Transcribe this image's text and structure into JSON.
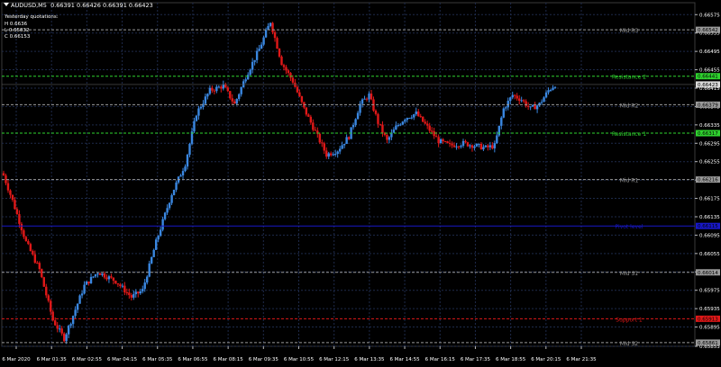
{
  "header": {
    "symbol": "AUDUSD,M5",
    "ohlc": "0.66391 0.66426 0.66391 0.66423"
  },
  "yesterday": {
    "title": "Yesterday quotations:",
    "high": "H  0.6636",
    "low": "L  0.65832",
    "close": "C  0.66153"
  },
  "colors": {
    "background": "#000000",
    "grid": "#1e2a4a",
    "axis": "#ffffff",
    "bull": "#3a87e0",
    "bear": "#e01818",
    "pivot": "#1818c8",
    "resistance": "#2fd32f",
    "support": "#e01818",
    "mid": "#9a9a9a"
  },
  "chart_data": {
    "type": "candlestick",
    "symbol": "AUDUSD",
    "timeframe": "M5",
    "ylim": [
      0.65853,
      0.66601
    ],
    "y_ticks": [
      "0.66575",
      "0.66535",
      "0.66495",
      "0.66455",
      "0.66415",
      "0.66375",
      "0.66335",
      "0.66295",
      "0.66255",
      "0.66215",
      "0.66175",
      "0.66135",
      "0.66095",
      "0.66055",
      "0.66015",
      "0.65975",
      "0.65935",
      "0.65895",
      "0.65853"
    ],
    "x_ticks": [
      "6 Mar 2020",
      "6 Mar 01:35",
      "6 Mar 02:55",
      "6 Mar 04:15",
      "6 Mar 05:35",
      "6 Mar 06:55",
      "6 Mar 08:15",
      "6 Mar 09:35",
      "6 Mar 10:55",
      "6 Mar 12:15",
      "6 Mar 13:35",
      "6 Mar 14:55",
      "6 Mar 16:15",
      "6 Mar 17:35",
      "6 Mar 18:55",
      "6 Mar 20:15",
      "6 Mar 21:35"
    ],
    "levels": [
      {
        "name": "Mid R3",
        "value": 0.66542,
        "kind": "mid",
        "price_label": "0.66542"
      },
      {
        "name": "Resistance 2",
        "value": 0.66441,
        "kind": "resistance",
        "price_label": "0.66441"
      },
      {
        "name": "Mid R2",
        "value": 0.66379,
        "kind": "mid",
        "price_label": "0.66379"
      },
      {
        "name": "Resistance 1",
        "value": 0.66317,
        "kind": "resistance",
        "price_label": "0.66317"
      },
      {
        "name": "Mid R1",
        "value": 0.66216,
        "kind": "mid",
        "price_label": "0.66216"
      },
      {
        "name": "Pivot level",
        "value": 0.66115,
        "kind": "pivot",
        "price_label": "0.66115"
      },
      {
        "name": "Mid S1",
        "value": 0.66014,
        "kind": "mid",
        "price_label": "0.66014"
      },
      {
        "name": "Support 1",
        "value": 0.65913,
        "kind": "support",
        "price_label": "0.65913"
      },
      {
        "name": "Mid S2",
        "value": 0.65861,
        "kind": "mid",
        "price_label": "0.65861"
      }
    ],
    "current_price": {
      "value": 0.66423,
      "label": "0.66423"
    },
    "close_path": [
      {
        "bar": 0,
        "price": 0.66225
      },
      {
        "bar": 4,
        "price": 0.6617
      },
      {
        "bar": 10,
        "price": 0.6608
      },
      {
        "bar": 16,
        "price": 0.6602
      },
      {
        "bar": 22,
        "price": 0.6591
      },
      {
        "bar": 27,
        "price": 0.6587
      },
      {
        "bar": 31,
        "price": 0.6592
      },
      {
        "bar": 36,
        "price": 0.65985
      },
      {
        "bar": 42,
        "price": 0.66015
      },
      {
        "bar": 50,
        "price": 0.65995
      },
      {
        "bar": 57,
        "price": 0.6596
      },
      {
        "bar": 62,
        "price": 0.65975
      },
      {
        "bar": 68,
        "price": 0.6608
      },
      {
        "bar": 75,
        "price": 0.66185
      },
      {
        "bar": 81,
        "price": 0.6625
      },
      {
        "bar": 86,
        "price": 0.6636
      },
      {
        "bar": 92,
        "price": 0.6641
      },
      {
        "bar": 98,
        "price": 0.6642
      },
      {
        "bar": 103,
        "price": 0.6638
      },
      {
        "bar": 108,
        "price": 0.6644
      },
      {
        "bar": 114,
        "price": 0.665
      },
      {
        "bar": 119,
        "price": 0.6656
      },
      {
        "bar": 124,
        "price": 0.6647
      },
      {
        "bar": 129,
        "price": 0.6643
      },
      {
        "bar": 134,
        "price": 0.6637
      },
      {
        "bar": 139,
        "price": 0.6632
      },
      {
        "bar": 144,
        "price": 0.6627
      },
      {
        "bar": 149,
        "price": 0.6628
      },
      {
        "bar": 154,
        "price": 0.6631
      },
      {
        "bar": 159,
        "price": 0.6638
      },
      {
        "bar": 163,
        "price": 0.664
      },
      {
        "bar": 167,
        "price": 0.6634
      },
      {
        "bar": 171,
        "price": 0.663
      },
      {
        "bar": 175,
        "price": 0.6633
      },
      {
        "bar": 179,
        "price": 0.6635
      },
      {
        "bar": 184,
        "price": 0.6636
      },
      {
        "bar": 189,
        "price": 0.6633
      },
      {
        "bar": 194,
        "price": 0.663
      },
      {
        "bar": 199,
        "price": 0.6629
      },
      {
        "bar": 205,
        "price": 0.66295
      },
      {
        "bar": 210,
        "price": 0.6629
      },
      {
        "bar": 215,
        "price": 0.66285
      },
      {
        "bar": 219,
        "price": 0.6629
      },
      {
        "bar": 223,
        "price": 0.6637
      },
      {
        "bar": 227,
        "price": 0.664
      },
      {
        "bar": 231,
        "price": 0.6639
      },
      {
        "bar": 235,
        "price": 0.6637
      },
      {
        "bar": 239,
        "price": 0.6638
      },
      {
        "bar": 243,
        "price": 0.6641
      },
      {
        "bar": 246,
        "price": 0.66423
      }
    ],
    "bars": 247
  }
}
